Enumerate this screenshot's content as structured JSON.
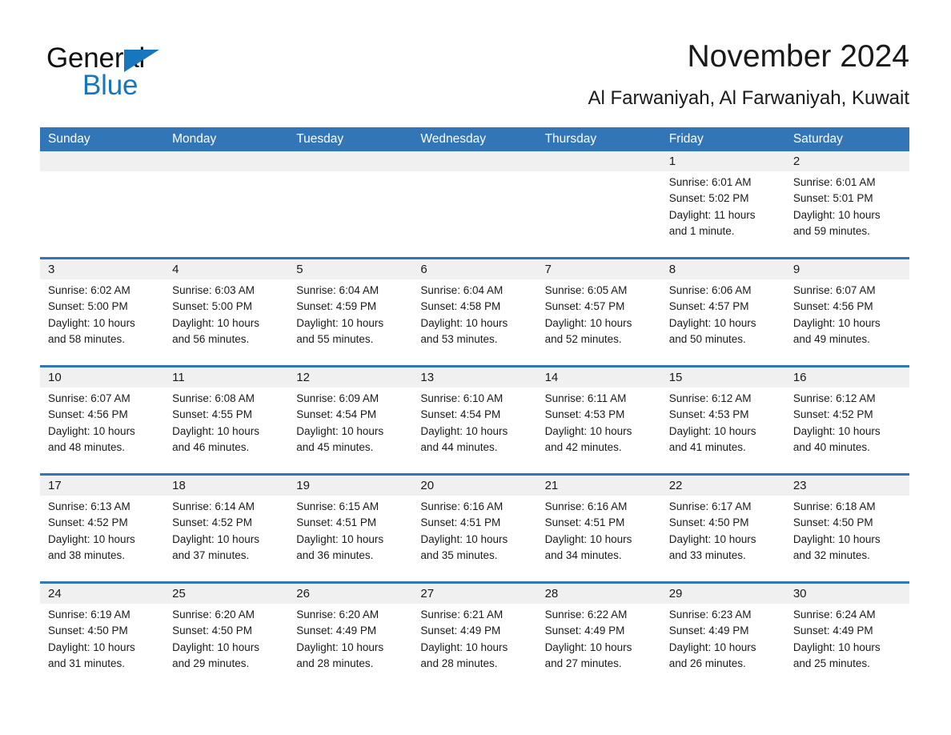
{
  "brand": {
    "name_part1": "General",
    "name_part2": "Blue",
    "triangle_color": "#1876bc"
  },
  "header": {
    "title": "November 2024",
    "subtitle": "Al Farwaniyah, Al Farwaniyah, Kuwait"
  },
  "theme": {
    "header_blue": "#3276b7",
    "daynum_band": "#f0f0f0",
    "text": "#1a1a1a"
  },
  "calendar": {
    "weekdays": [
      "Sunday",
      "Monday",
      "Tuesday",
      "Wednesday",
      "Thursday",
      "Friday",
      "Saturday"
    ],
    "weeks": [
      {
        "days": [
          {
            "num": "",
            "lines": []
          },
          {
            "num": "",
            "lines": []
          },
          {
            "num": "",
            "lines": []
          },
          {
            "num": "",
            "lines": []
          },
          {
            "num": "",
            "lines": []
          },
          {
            "num": "1",
            "lines": [
              "Sunrise: 6:01 AM",
              "Sunset: 5:02 PM",
              "Daylight: 11 hours",
              "and 1 minute."
            ]
          },
          {
            "num": "2",
            "lines": [
              "Sunrise: 6:01 AM",
              "Sunset: 5:01 PM",
              "Daylight: 10 hours",
              "and 59 minutes."
            ]
          }
        ]
      },
      {
        "days": [
          {
            "num": "3",
            "lines": [
              "Sunrise: 6:02 AM",
              "Sunset: 5:00 PM",
              "Daylight: 10 hours",
              "and 58 minutes."
            ]
          },
          {
            "num": "4",
            "lines": [
              "Sunrise: 6:03 AM",
              "Sunset: 5:00 PM",
              "Daylight: 10 hours",
              "and 56 minutes."
            ]
          },
          {
            "num": "5",
            "lines": [
              "Sunrise: 6:04 AM",
              "Sunset: 4:59 PM",
              "Daylight: 10 hours",
              "and 55 minutes."
            ]
          },
          {
            "num": "6",
            "lines": [
              "Sunrise: 6:04 AM",
              "Sunset: 4:58 PM",
              "Daylight: 10 hours",
              "and 53 minutes."
            ]
          },
          {
            "num": "7",
            "lines": [
              "Sunrise: 6:05 AM",
              "Sunset: 4:57 PM",
              "Daylight: 10 hours",
              "and 52 minutes."
            ]
          },
          {
            "num": "8",
            "lines": [
              "Sunrise: 6:06 AM",
              "Sunset: 4:57 PM",
              "Daylight: 10 hours",
              "and 50 minutes."
            ]
          },
          {
            "num": "9",
            "lines": [
              "Sunrise: 6:07 AM",
              "Sunset: 4:56 PM",
              "Daylight: 10 hours",
              "and 49 minutes."
            ]
          }
        ]
      },
      {
        "days": [
          {
            "num": "10",
            "lines": [
              "Sunrise: 6:07 AM",
              "Sunset: 4:56 PM",
              "Daylight: 10 hours",
              "and 48 minutes."
            ]
          },
          {
            "num": "11",
            "lines": [
              "Sunrise: 6:08 AM",
              "Sunset: 4:55 PM",
              "Daylight: 10 hours",
              "and 46 minutes."
            ]
          },
          {
            "num": "12",
            "lines": [
              "Sunrise: 6:09 AM",
              "Sunset: 4:54 PM",
              "Daylight: 10 hours",
              "and 45 minutes."
            ]
          },
          {
            "num": "13",
            "lines": [
              "Sunrise: 6:10 AM",
              "Sunset: 4:54 PM",
              "Daylight: 10 hours",
              "and 44 minutes."
            ]
          },
          {
            "num": "14",
            "lines": [
              "Sunrise: 6:11 AM",
              "Sunset: 4:53 PM",
              "Daylight: 10 hours",
              "and 42 minutes."
            ]
          },
          {
            "num": "15",
            "lines": [
              "Sunrise: 6:12 AM",
              "Sunset: 4:53 PM",
              "Daylight: 10 hours",
              "and 41 minutes."
            ]
          },
          {
            "num": "16",
            "lines": [
              "Sunrise: 6:12 AM",
              "Sunset: 4:52 PM",
              "Daylight: 10 hours",
              "and 40 minutes."
            ]
          }
        ]
      },
      {
        "days": [
          {
            "num": "17",
            "lines": [
              "Sunrise: 6:13 AM",
              "Sunset: 4:52 PM",
              "Daylight: 10 hours",
              "and 38 minutes."
            ]
          },
          {
            "num": "18",
            "lines": [
              "Sunrise: 6:14 AM",
              "Sunset: 4:52 PM",
              "Daylight: 10 hours",
              "and 37 minutes."
            ]
          },
          {
            "num": "19",
            "lines": [
              "Sunrise: 6:15 AM",
              "Sunset: 4:51 PM",
              "Daylight: 10 hours",
              "and 36 minutes."
            ]
          },
          {
            "num": "20",
            "lines": [
              "Sunrise: 6:16 AM",
              "Sunset: 4:51 PM",
              "Daylight: 10 hours",
              "and 35 minutes."
            ]
          },
          {
            "num": "21",
            "lines": [
              "Sunrise: 6:16 AM",
              "Sunset: 4:51 PM",
              "Daylight: 10 hours",
              "and 34 minutes."
            ]
          },
          {
            "num": "22",
            "lines": [
              "Sunrise: 6:17 AM",
              "Sunset: 4:50 PM",
              "Daylight: 10 hours",
              "and 33 minutes."
            ]
          },
          {
            "num": "23",
            "lines": [
              "Sunrise: 6:18 AM",
              "Sunset: 4:50 PM",
              "Daylight: 10 hours",
              "and 32 minutes."
            ]
          }
        ]
      },
      {
        "days": [
          {
            "num": "24",
            "lines": [
              "Sunrise: 6:19 AM",
              "Sunset: 4:50 PM",
              "Daylight: 10 hours",
              "and 31 minutes."
            ]
          },
          {
            "num": "25",
            "lines": [
              "Sunrise: 6:20 AM",
              "Sunset: 4:50 PM",
              "Daylight: 10 hours",
              "and 29 minutes."
            ]
          },
          {
            "num": "26",
            "lines": [
              "Sunrise: 6:20 AM",
              "Sunset: 4:49 PM",
              "Daylight: 10 hours",
              "and 28 minutes."
            ]
          },
          {
            "num": "27",
            "lines": [
              "Sunrise: 6:21 AM",
              "Sunset: 4:49 PM",
              "Daylight: 10 hours",
              "and 28 minutes."
            ]
          },
          {
            "num": "28",
            "lines": [
              "Sunrise: 6:22 AM",
              "Sunset: 4:49 PM",
              "Daylight: 10 hours",
              "and 27 minutes."
            ]
          },
          {
            "num": "29",
            "lines": [
              "Sunrise: 6:23 AM",
              "Sunset: 4:49 PM",
              "Daylight: 10 hours",
              "and 26 minutes."
            ]
          },
          {
            "num": "30",
            "lines": [
              "Sunrise: 6:24 AM",
              "Sunset: 4:49 PM",
              "Daylight: 10 hours",
              "and 25 minutes."
            ]
          }
        ]
      }
    ]
  }
}
